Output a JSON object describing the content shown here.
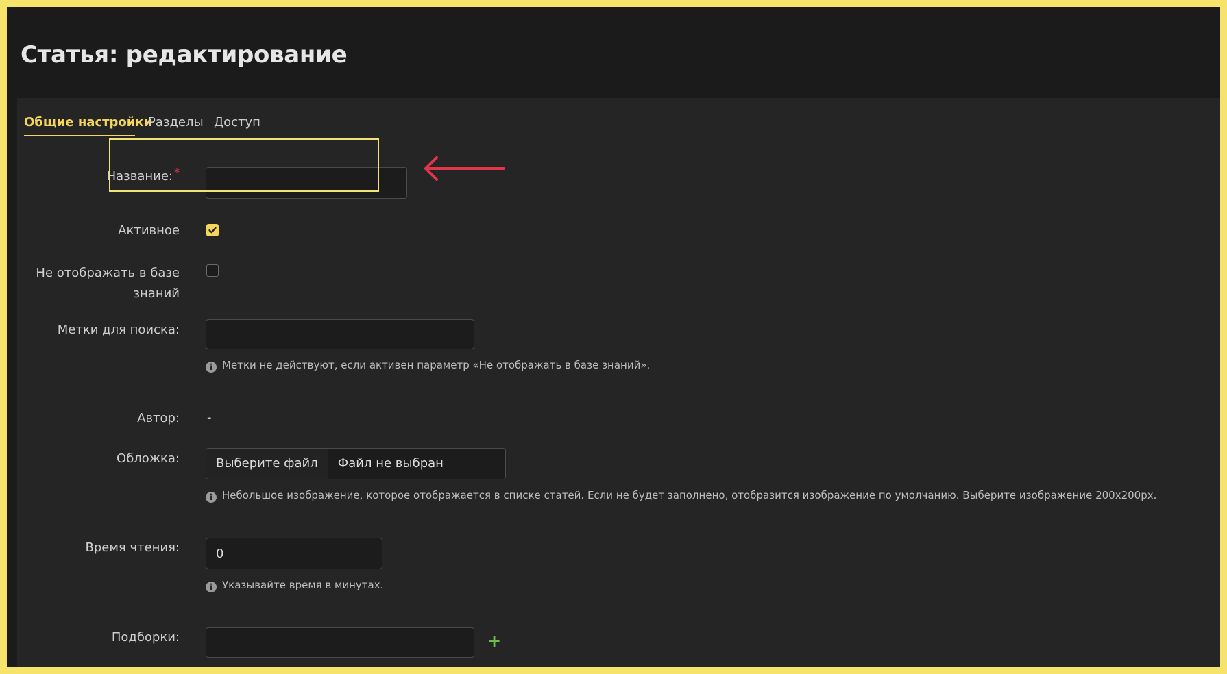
{
  "page": {
    "title": "Статья: редактирование"
  },
  "tabs": [
    {
      "label": "Общие настройки",
      "active": true
    },
    {
      "label": "Разделы",
      "active": false
    },
    {
      "label": "Доступ",
      "active": false
    }
  ],
  "form": {
    "name": {
      "label": "Название:",
      "required_mark": "*",
      "value": ""
    },
    "active": {
      "label": "Активное",
      "checked": true
    },
    "hide_in_kb": {
      "label_line1": "Не отображать в базе",
      "label_line2": "знаний",
      "checked": false
    },
    "search_tags": {
      "label": "Метки для поиска:",
      "value": "",
      "hint": "Метки не действуют, если активен параметр «Не отображать в базе знаний»."
    },
    "author": {
      "label": "Автор:",
      "value": "-"
    },
    "cover": {
      "label": "Обложка:",
      "button_label": "Выберите файл",
      "status": "Файл не выбран",
      "hint": "Небольшое изображение, которое отображается в списке статей. Если не будет заполнено, отобразится изображение по умолчанию. Выберите изображение 200x200px."
    },
    "reading_time": {
      "label": "Время чтения:",
      "value": "0",
      "hint": "Указывайте время в минутах."
    },
    "collections": {
      "label": "Подборки:",
      "value": "",
      "add_icon": "+"
    }
  },
  "icons": {
    "info": "info-icon",
    "add": "plus-icon",
    "check": "check-icon",
    "annotation": "arrow-left-icon"
  },
  "colors": {
    "accent": "#f3d65a",
    "background": "#1b1b1b",
    "panel": "#252525",
    "required": "#e0364a",
    "add": "#6cc04a",
    "annotation_arrow": "#e0364a",
    "annotation_box": "#f3e377"
  }
}
